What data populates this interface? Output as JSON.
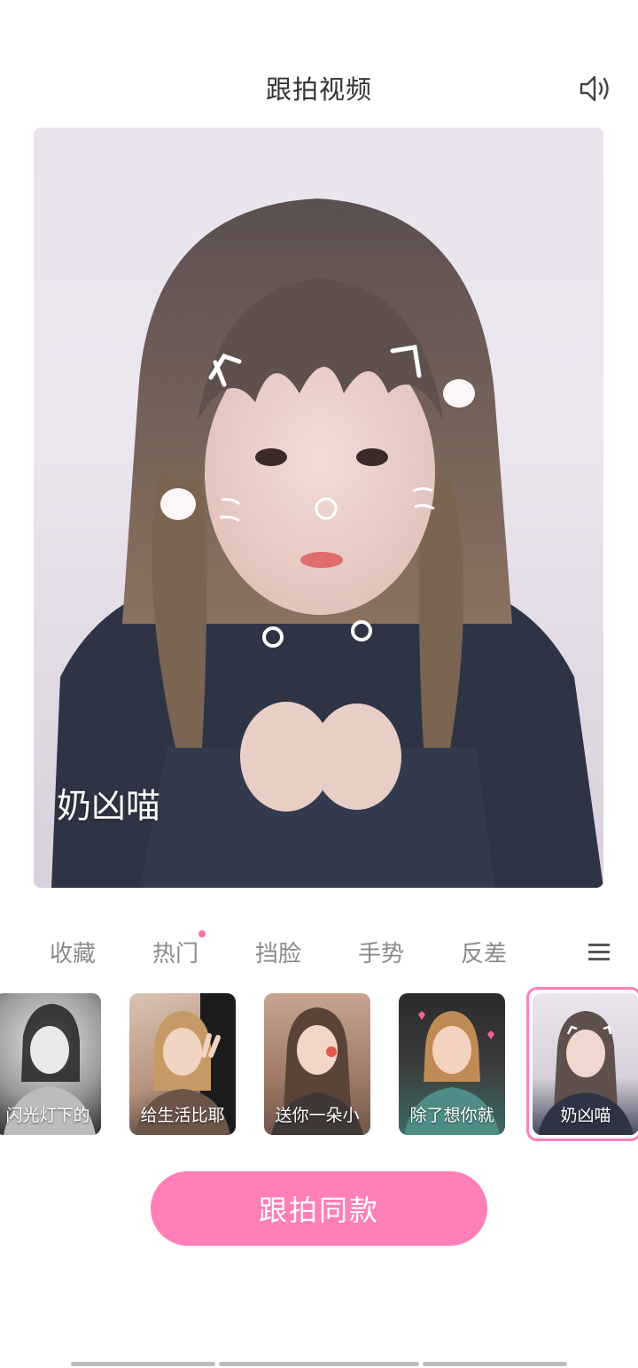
{
  "header": {
    "title": "跟拍视频",
    "sound_icon": "speaker-icon"
  },
  "preview": {
    "caption": "奶凶喵"
  },
  "tabs": [
    {
      "label": "收藏"
    },
    {
      "label": "热门",
      "has_dot": true
    },
    {
      "label": "挡脸"
    },
    {
      "label": "手势"
    },
    {
      "label": "反差"
    }
  ],
  "menu_icon": "menu-icon",
  "thumbnails": [
    {
      "label": "闪光灯下的"
    },
    {
      "label": "给生活比耶"
    },
    {
      "label": "送你一朵小"
    },
    {
      "label": "除了想你就"
    },
    {
      "label": "奶凶喵",
      "selected": true
    }
  ],
  "cta": {
    "label": "跟拍同款"
  },
  "colors": {
    "accent": "#ff7fb6",
    "dot": "#ff6fa8",
    "title": "#333333",
    "tab_text": "#8a8a8a"
  }
}
